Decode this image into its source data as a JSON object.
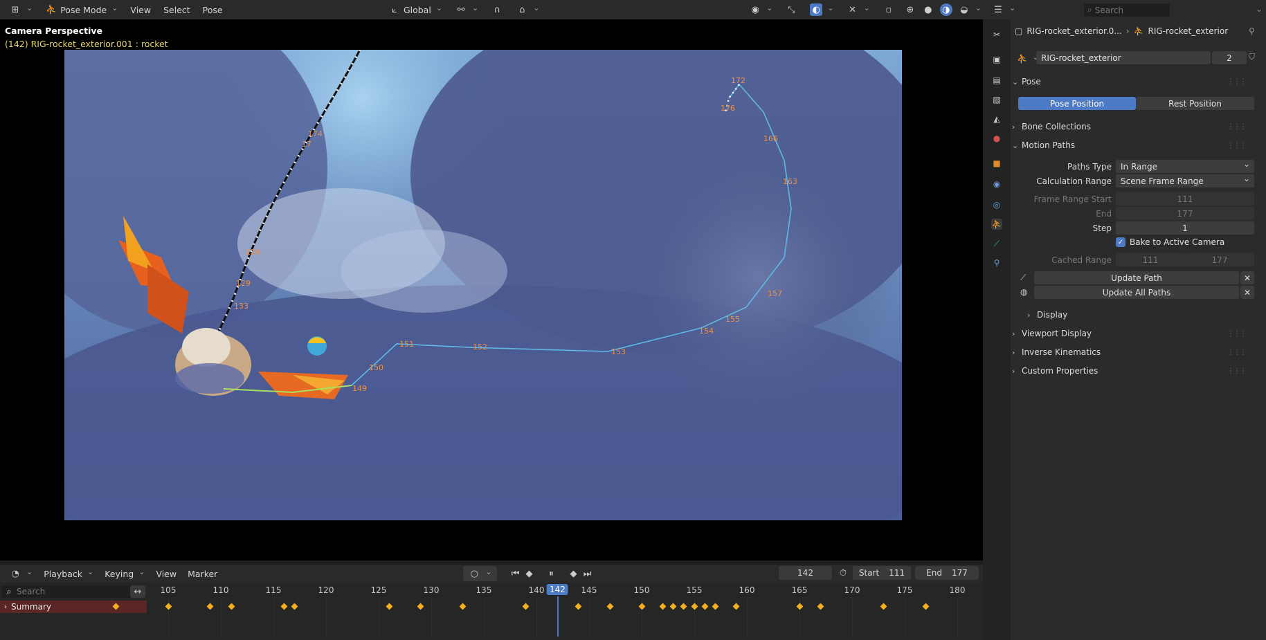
{
  "header": {
    "mode_label": "Pose Mode",
    "menus": [
      "View",
      "Select",
      "Pose"
    ],
    "orientation": "Global"
  },
  "viewport": {
    "title": "Camera Perspective",
    "subtitle": "(142) RIG-rocket_exterior.001 : rocket",
    "path_labels": [
      "172",
      "176",
      "166",
      "163",
      "157",
      "155",
      "154",
      "153",
      "152",
      "151",
      "150",
      "149",
      "133",
      "129",
      "126",
      "17",
      "174"
    ]
  },
  "timeline": {
    "menus": [
      "Playback",
      "Keying",
      "View",
      "Marker"
    ],
    "current_frame": "142",
    "start_label": "Start",
    "start_value": "111",
    "end_label": "End",
    "end_value": "177",
    "search_placeholder": "Search",
    "summary_label": "Summary",
    "ruler_ticks": [
      "105",
      "110",
      "115",
      "120",
      "125",
      "130",
      "135",
      "140",
      "145",
      "150",
      "155",
      "160",
      "165",
      "170",
      "175",
      "180"
    ],
    "playhead_label": "142",
    "keyframes": [
      100,
      105,
      109,
      111,
      116,
      117,
      126,
      129,
      133,
      139,
      144,
      147,
      150,
      152,
      153,
      154,
      155,
      156,
      157,
      159,
      165,
      167,
      173,
      177
    ]
  },
  "properties": {
    "search_placeholder": "Search",
    "breadcrumb_object": "RIG-rocket_exterior.0...",
    "breadcrumb_data": "RIG-rocket_exterior",
    "datablock_name": "RIG-rocket_exterior",
    "datablock_users": "2",
    "pose_section": "Pose",
    "pose_position": "Pose Position",
    "rest_position": "Rest Position",
    "bone_collections": "Bone Collections",
    "motion_paths": "Motion Paths",
    "paths_type_label": "Paths Type",
    "paths_type_value": "In Range",
    "calc_range_label": "Calculation Range",
    "calc_range_value": "Scene Frame Range",
    "frame_start_label": "Frame Range Start",
    "frame_start_value": "111",
    "end_label": "End",
    "end_value": "177",
    "step_label": "Step",
    "step_value": "1",
    "bake_label": "Bake to Active Camera",
    "cached_range_label": "Cached Range",
    "cached_start": "111",
    "cached_end": "177",
    "update_path": "Update Path",
    "update_all_paths": "Update All Paths",
    "display": "Display",
    "viewport_display": "Viewport Display",
    "inverse_kinematics": "Inverse Kinematics",
    "custom_properties": "Custom Properties"
  },
  "colors": {
    "accent_blue": "#4c7ac4",
    "keyframe": "#f5b021",
    "summary_bg": "#5a2626",
    "path_label": "#e8924a"
  }
}
